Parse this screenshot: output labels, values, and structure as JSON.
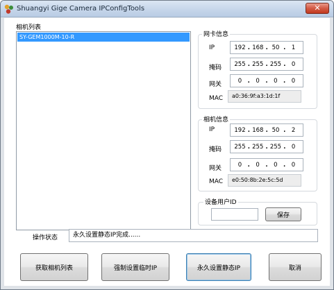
{
  "window": {
    "title": "Shuangyi Gige Camera IPConfigTools",
    "close_glyph": "✕",
    "icon": "app-icon"
  },
  "camera_list": {
    "label": "相机列表",
    "items": [
      "SY-GEM1000M-10-R"
    ]
  },
  "nic_info": {
    "title": "网卡信息",
    "ip_label": "IP",
    "ip": [
      "192",
      "168",
      "50",
      "1"
    ],
    "mask_label": "掩码",
    "mask": [
      "255",
      "255",
      "255",
      "0"
    ],
    "gateway_label": "网关",
    "gateway": [
      "0",
      "0",
      "0",
      "0"
    ],
    "mac_label": "MAC",
    "mac": "a0:36:9f:a3:1d:1f"
  },
  "camera_info": {
    "title": "相机信息",
    "ip_label": "IP",
    "ip": [
      "192",
      "168",
      "50",
      "2"
    ],
    "mask_label": "掩码",
    "mask": [
      "255",
      "255",
      "255",
      "0"
    ],
    "gateway_label": "网关",
    "gateway": [
      "0",
      "0",
      "0",
      "0"
    ],
    "mac_label": "MAC",
    "mac": "e0:50:8b:2e:5c:5d"
  },
  "user_id": {
    "title": "设备用户ID",
    "value": "",
    "save_label": "保存"
  },
  "status": {
    "label": "操作状态",
    "text": "永久设置静态IP完成......"
  },
  "buttons": {
    "get_list": "获取相机列表",
    "force_temp_ip": "强制设置临时IP",
    "set_static_ip": "永久设置静态IP",
    "cancel": "取消"
  }
}
